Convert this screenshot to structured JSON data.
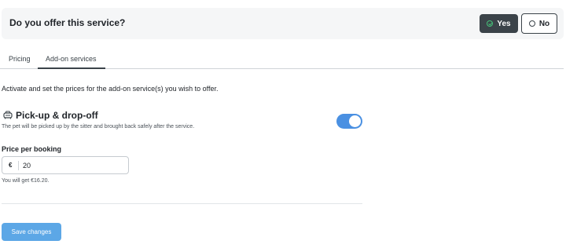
{
  "service_header": {
    "question": "Do you offer this service?",
    "yes_label": "Yes",
    "no_label": "No",
    "selected": "Yes"
  },
  "tabs": [
    {
      "label": "Pricing",
      "active": false
    },
    {
      "label": "Add-on services",
      "active": true
    }
  ],
  "intro_text": "Activate and set the prices for the add-on service(s) you wish to offer.",
  "addon": {
    "icon": "car-icon",
    "title": "Pick-up & drop-off",
    "description": "The pet will be picked up by the sitter and brought back safely after the service.",
    "enabled": true
  },
  "price": {
    "label": "Price per booking",
    "currency": "€",
    "value": "20",
    "earnings_note": "You will get €16.20."
  },
  "save_label": "Save changes",
  "colors": {
    "yes_button_bg": "#3b4349",
    "check_green": "#47c27a",
    "toggle_on": "#4a90e2",
    "save_button_bg": "#5ca7e6"
  }
}
